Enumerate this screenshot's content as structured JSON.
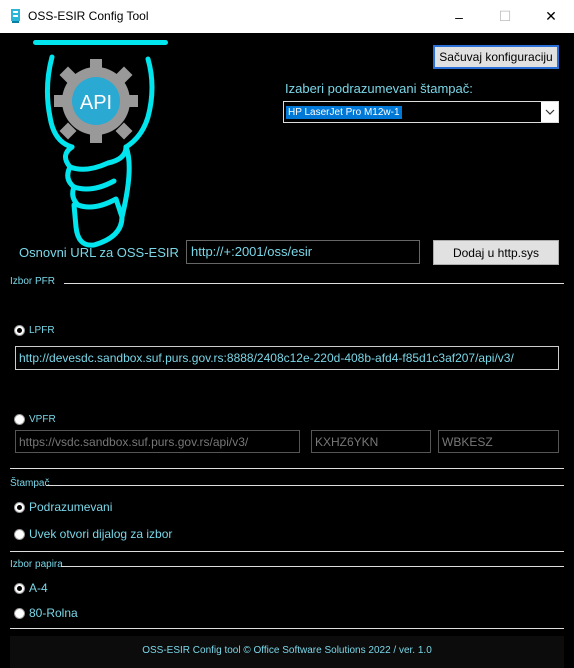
{
  "window": {
    "title": "OSS-ESIR Config Tool",
    "minimize": "–",
    "maximize": "☐",
    "close": "✕"
  },
  "logo": {
    "text": "API"
  },
  "toolbar": {
    "save_label": "Sačuvaj konfiguraciju"
  },
  "printer": {
    "label": "Izaberi podrazumevani štampač:",
    "selected": "HP LaserJet Pro M12w-1"
  },
  "base_url": {
    "label": "Osnovni URL za OSS-ESIR",
    "value": "http://+:2001/oss/esir",
    "button": "Dodaj u http.sys"
  },
  "pfr": {
    "group_label": "Izbor PFR",
    "lpfr_label": "LPFR",
    "lpfr_url": "http://devesdc.sandbox.suf.purs.gov.rs:8888/2408c12e-220d-408b-afd4-f85d1c3af207/api/v3/",
    "vpfr_label": "VPFR",
    "vpfr_url": "https://vsdc.sandbox.suf.purs.gov.rs/api/v3/",
    "vpfr_field2": "KXHZ6YKN",
    "vpfr_field3": "WBKESZ"
  },
  "stampac": {
    "group_label": "Štampač",
    "opt1": "Podrazumevani",
    "opt2": "Uvek otvori dijalog za izbor"
  },
  "papir": {
    "group_label": "Izbor papira",
    "opt1": "A-4",
    "opt2": "80-Rolna"
  },
  "footer": {
    "text": "OSS-ESIR Config tool © Office Software Solutions 2022 / ver. 1.0"
  },
  "colors": {
    "accent": "#00e5ee",
    "text": "#7ad7e8",
    "selection": "#0078d7"
  }
}
